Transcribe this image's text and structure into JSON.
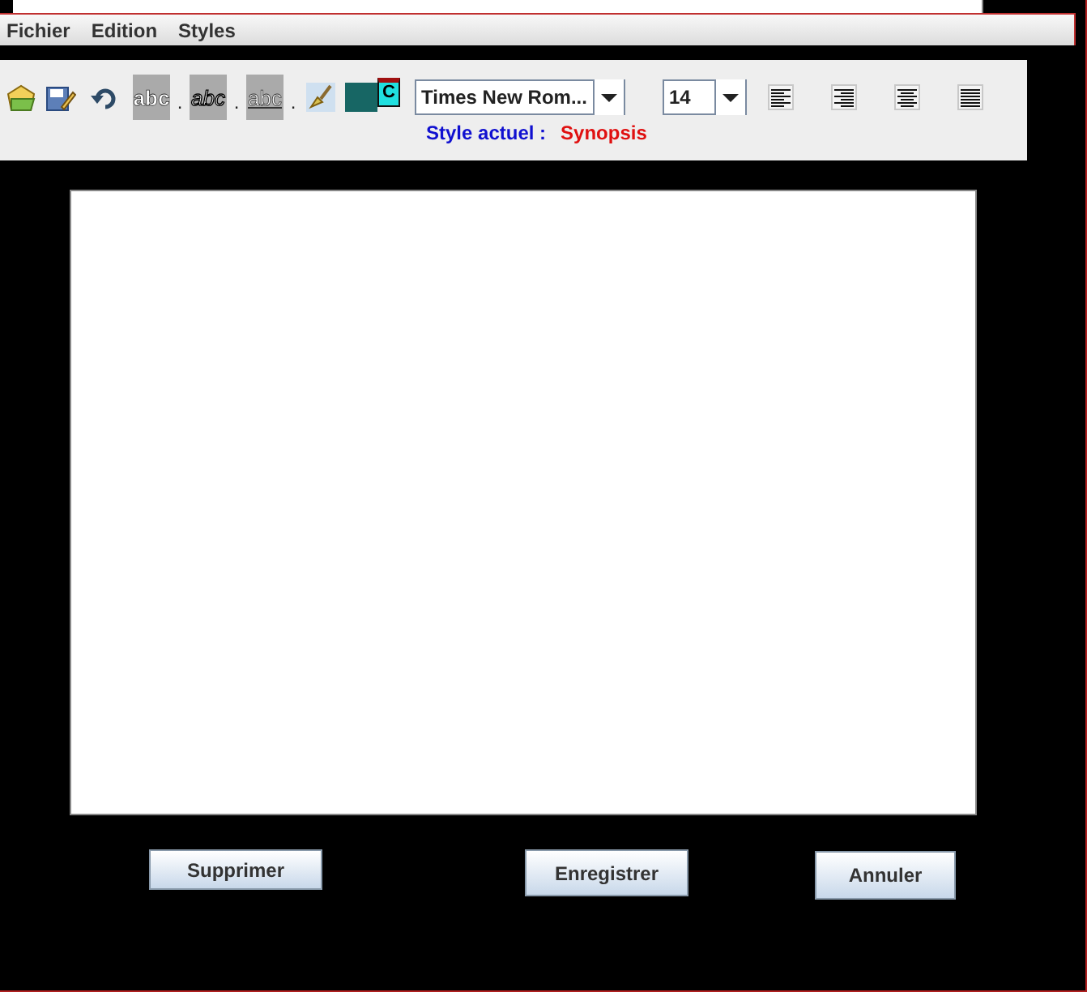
{
  "menu": [
    "Fichier",
    "Edition",
    "Styles"
  ],
  "toolbar": {
    "style_buttons": [
      {
        "label": "abc",
        "kind": "bold",
        "separator": "."
      },
      {
        "label": "abc",
        "kind": "italic",
        "separator": "."
      },
      {
        "label": "abc",
        "kind": "underline",
        "separator": "."
      }
    ],
    "color_picker_glyph": "C",
    "font": {
      "value": "Times New Rom..."
    },
    "size": {
      "value": "14"
    },
    "alignments": [
      {
        "kind": "left"
      },
      {
        "kind": "right"
      },
      {
        "kind": "center"
      },
      {
        "kind": "justify"
      }
    ],
    "style_label": "Style actuel :",
    "style_value": "Synopsis"
  },
  "buttons": [
    "Supprimer",
    "Enregistrer",
    "Annuler"
  ]
}
